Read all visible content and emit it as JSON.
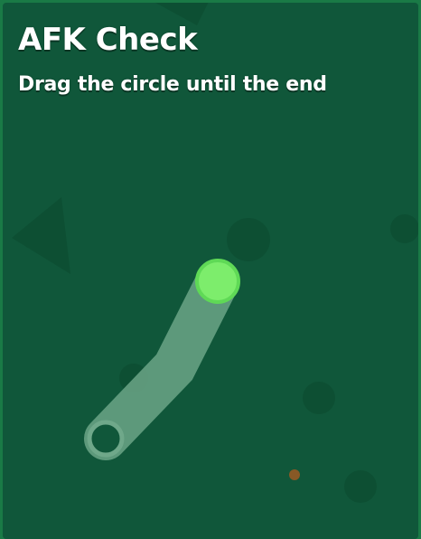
{
  "afk_check": {
    "title": "AFK Check",
    "instruction": "Drag the circle until the end"
  },
  "colors": {
    "border": "#1a7a46",
    "background": "#10573a",
    "track": "#6fa88a",
    "handle_fill": "#7ded6c",
    "handle_ring": "#5fd956",
    "end_ring": "#6fa88a",
    "text": "#ffffff"
  },
  "drag_progress": 0
}
